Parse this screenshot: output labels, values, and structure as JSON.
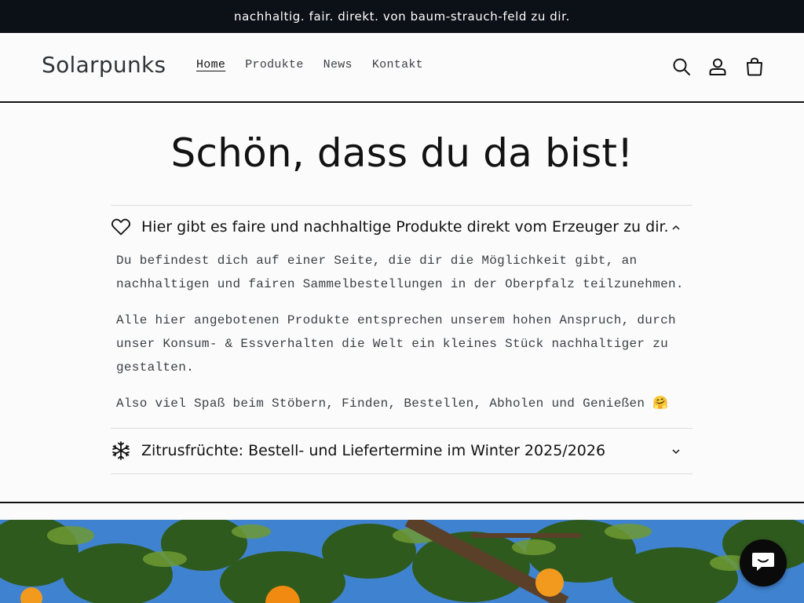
{
  "announcement": {
    "text": "nachhaltig. fair. direkt. von baum-strauch-feld zu dir."
  },
  "header": {
    "logo": "Solarpunks",
    "nav": [
      "Home",
      "Produkte",
      "News",
      "Kontakt"
    ],
    "icons": [
      "search-icon",
      "account-icon",
      "cart-icon"
    ]
  },
  "main": {
    "title": "Schön, dass du da bist!",
    "accordion": [
      {
        "icon": "heart-icon",
        "title": "Hier gibt es faire und nachhaltige Produkte direkt vom Erzeuger zu dir.",
        "expanded": true,
        "paragraphs": [
          "Du befindest dich auf einer Seite, die dir die Möglichkeit gibt, an nachhaltigen und fairen Sammelbestellungen in der Oberpfalz teilzunehmen.",
          "Alle hier angebotenen Produkte entsprechen unserem hohen Anspruch, durch unser Konsum- & Essverhalten die Welt ein kleines Stück nachhaltiger zu gestalten.",
          "Also viel Spaß beim Stöbern, Finden, Bestellen, Abholen und Genießen 🤗"
        ]
      },
      {
        "icon": "snowflake-icon",
        "title": "Zitrusfrüchte: Bestell- und Liefertermine im Winter 2025/2026",
        "expanded": false
      }
    ]
  },
  "chat": {
    "icon": "chat-icon"
  },
  "colors": {
    "announcement_bg": "#0c1017",
    "page_bg": "#fcfbfb",
    "text": "#121212"
  }
}
